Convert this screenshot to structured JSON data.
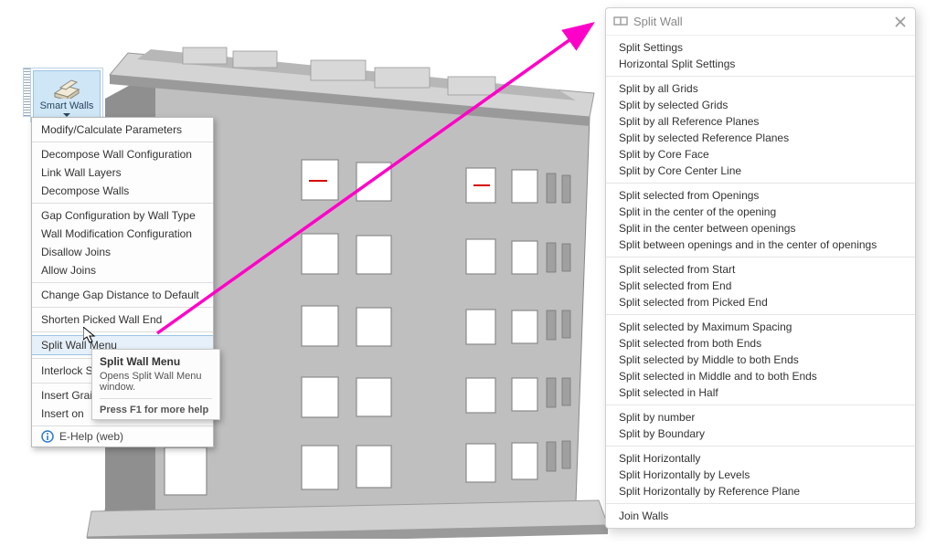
{
  "colors": {
    "building_face": "#bfbfbf",
    "building_roof": "#a8a8a8",
    "arrow": "#ff00c8",
    "highlight": "#e6f0fa"
  },
  "toolbar": {
    "button_label": "Smart Walls",
    "button_icon": "wall-icon"
  },
  "dropdown": {
    "groups": [
      [
        "Modify/Calculate Parameters"
      ],
      [
        "Decompose Wall Configuration",
        "Link Wall Layers",
        "Decompose Walls"
      ],
      [
        "Gap Configuration by Wall Type",
        "Wall Modification Configuration",
        "Disallow Joins",
        "Allow Joins"
      ],
      [
        "Change Gap Distance to Default"
      ],
      [
        "Shorten Picked Wall End"
      ],
      [
        "Split Wall Menu"
      ],
      [
        "Interlock Split Walls"
      ],
      [
        "Insert Grains",
        "Insert on"
      ]
    ],
    "highlighted": "Split Wall Menu",
    "help_label": "E-Help (web)",
    "help_icon": "info-icon"
  },
  "tooltip": {
    "title": "Split Wall Menu",
    "description": "Opens Split Wall Menu window.",
    "hint": "Press F1 for more help"
  },
  "split_panel": {
    "title": "Split Wall",
    "close_icon": "close-icon",
    "groups": [
      [
        "Split Settings",
        "Horizontal Split Settings"
      ],
      [
        "Split by all Grids",
        "Split by selected Grids",
        "Split by all Reference Planes",
        "Split by selected Reference Planes",
        "Split by Core Face",
        "Split by Core Center Line"
      ],
      [
        "Split selected from Openings",
        "Split in the center of the opening",
        "Split in the center between openings",
        "Split between openings and in the center of openings"
      ],
      [
        "Split selected from Start",
        "Split selected from End",
        "Split selected from Picked End"
      ],
      [
        "Split selected by Maximum Spacing",
        "Split selected from both Ends",
        "Split selected by Middle to both Ends",
        "Split selected in Middle and to both Ends",
        "Split selected in Half"
      ],
      [
        "Split by number",
        "Split by Boundary"
      ],
      [
        "Split Horizontally",
        "Split Horizontally by Levels",
        "Split Horizontally by Reference Plane"
      ],
      [
        "Join Walls"
      ]
    ]
  }
}
